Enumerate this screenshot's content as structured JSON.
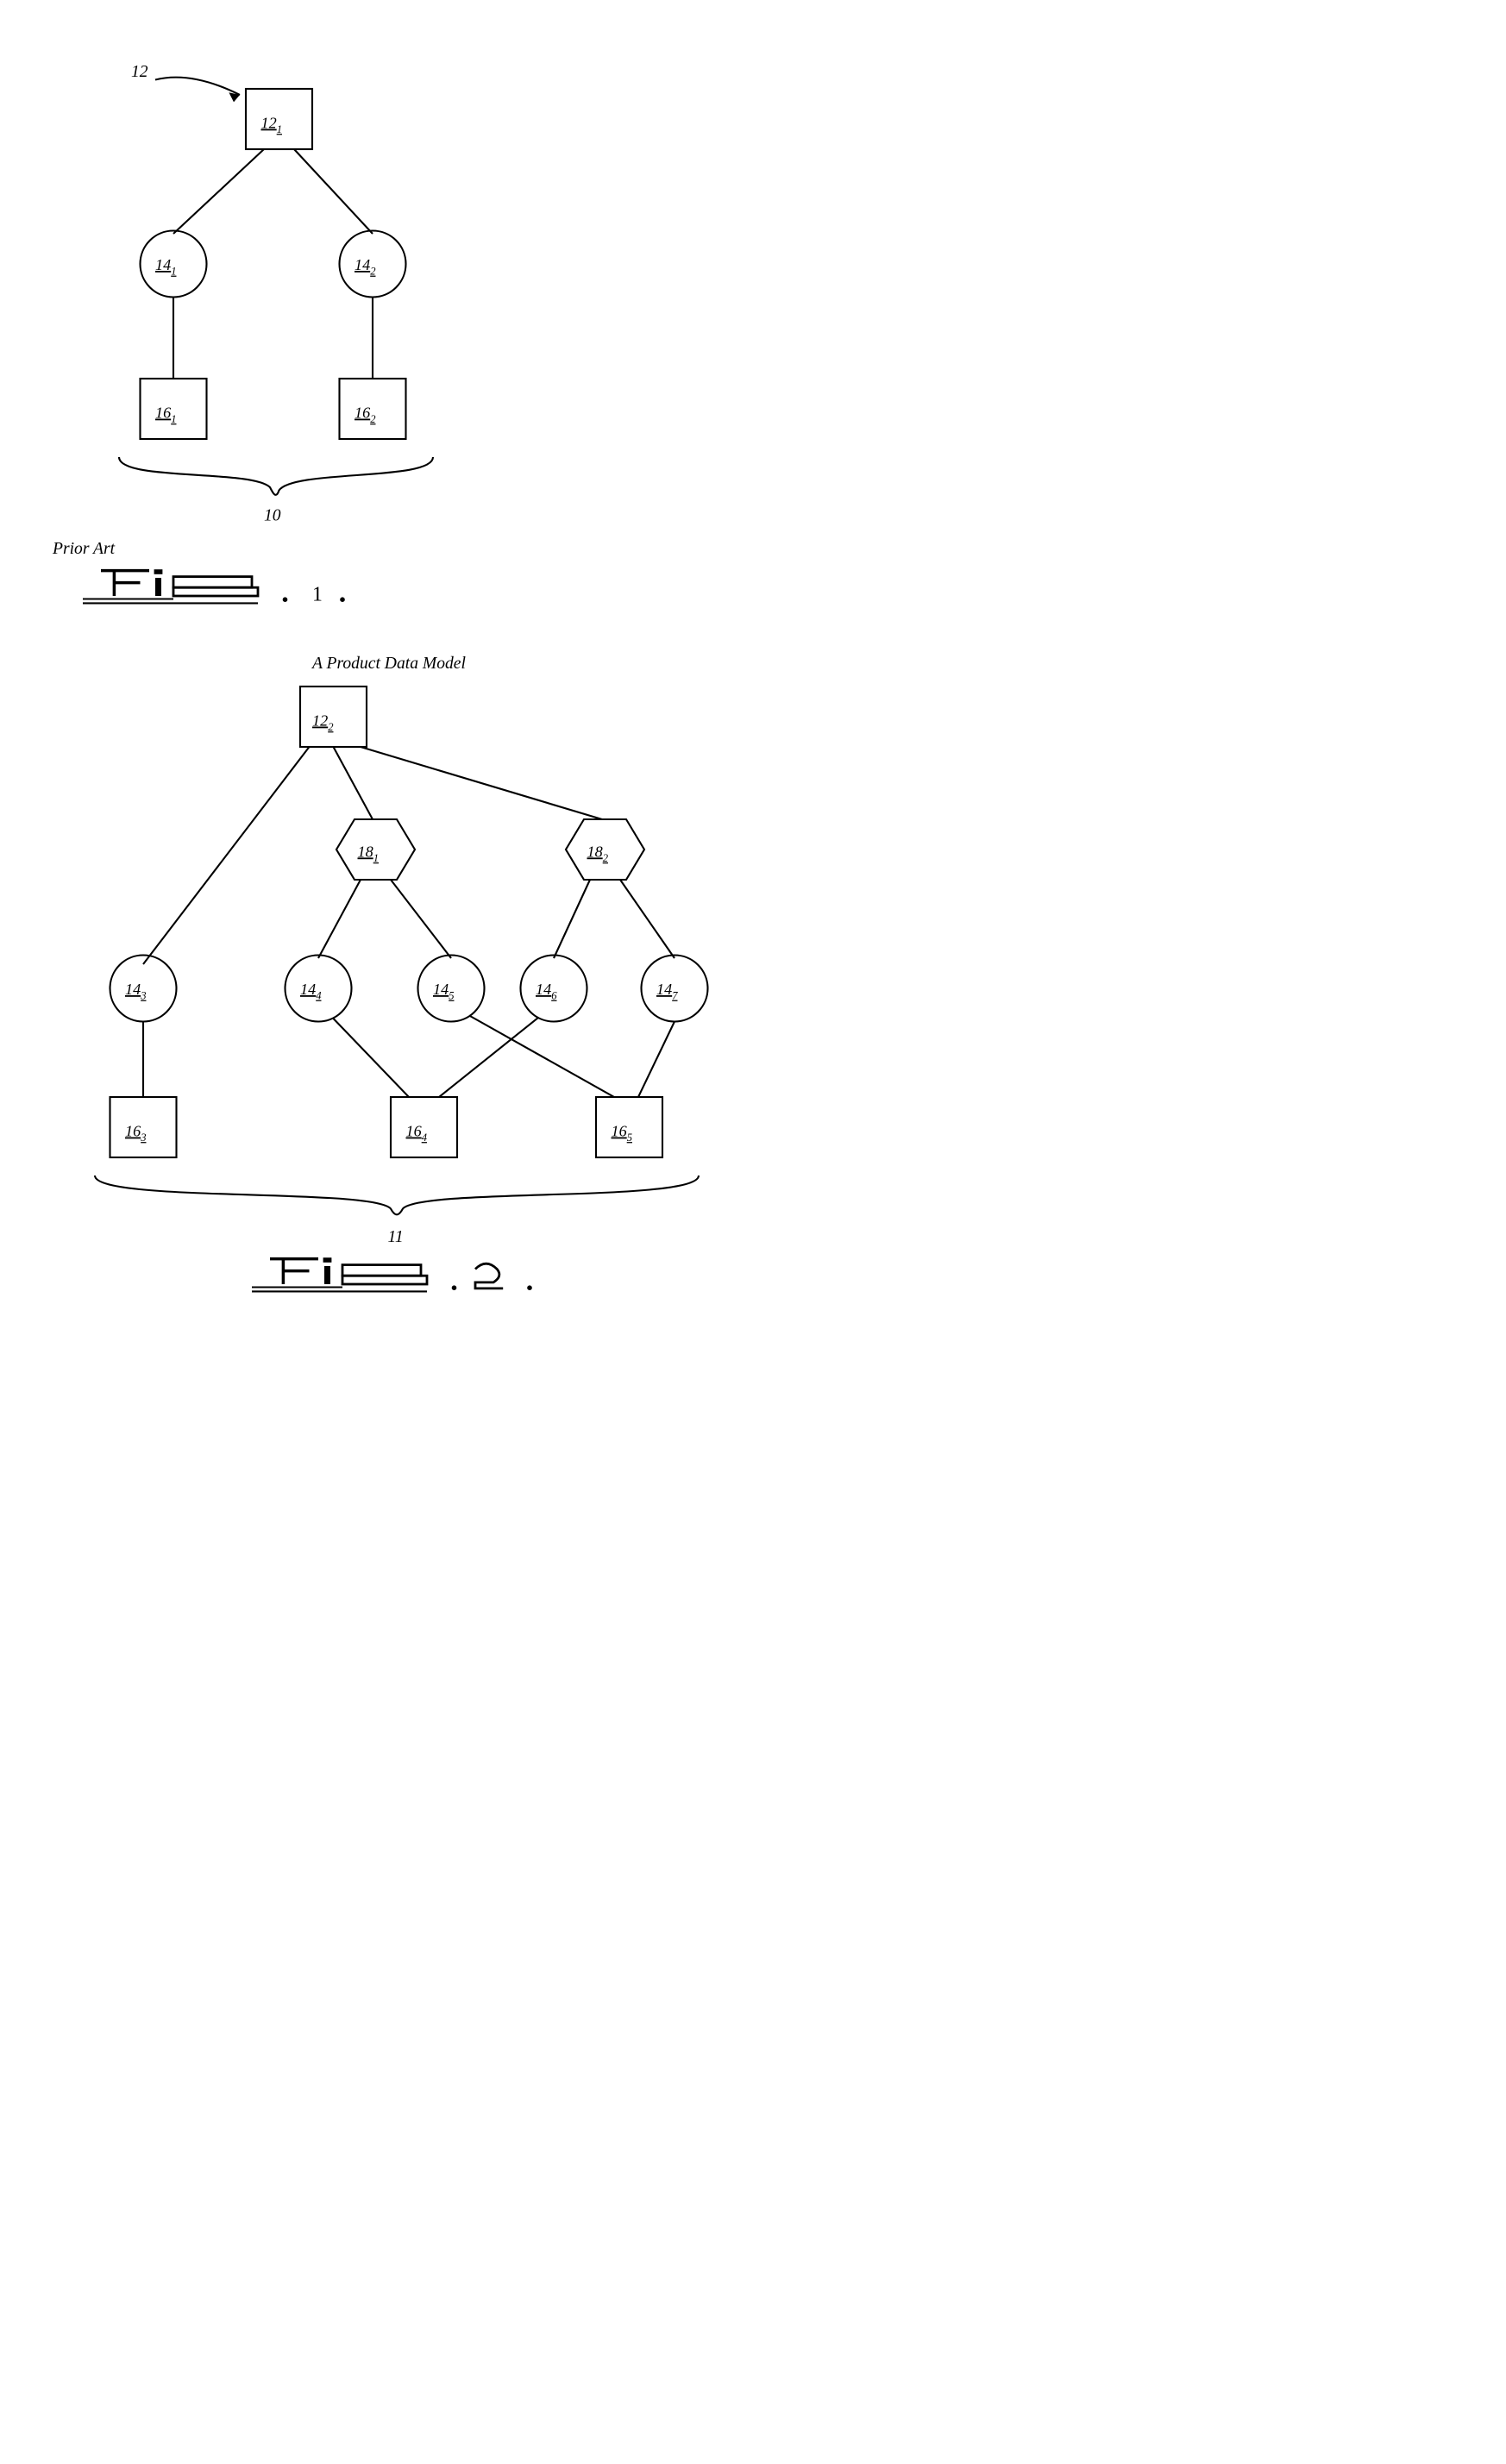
{
  "fig1": {
    "pointer_label": "12",
    "prior_art": "Prior Art",
    "brace_label": "10",
    "fig_number": "1",
    "nodes": {
      "root": {
        "base": "12",
        "sub": "1"
      },
      "c1": {
        "base": "14",
        "sub": "1"
      },
      "c2": {
        "base": "14",
        "sub": "2"
      },
      "l1": {
        "base": "16",
        "sub": "1"
      },
      "l2": {
        "base": "16",
        "sub": "2"
      }
    }
  },
  "fig2": {
    "title": "A Product Data Model",
    "brace_label": "11",
    "fig_number": "2",
    "nodes": {
      "root": {
        "base": "12",
        "sub": "2"
      },
      "h1": {
        "base": "18",
        "sub": "1"
      },
      "h2": {
        "base": "18",
        "sub": "2"
      },
      "c3": {
        "base": "14",
        "sub": "3"
      },
      "c4": {
        "base": "14",
        "sub": "4"
      },
      "c5": {
        "base": "14",
        "sub": "5"
      },
      "c6": {
        "base": "14",
        "sub": "6"
      },
      "c7": {
        "base": "14",
        "sub": "7"
      },
      "l3": {
        "base": "16",
        "sub": "3"
      },
      "l4": {
        "base": "16",
        "sub": "4"
      },
      "l5": {
        "base": "16",
        "sub": "5"
      }
    }
  }
}
